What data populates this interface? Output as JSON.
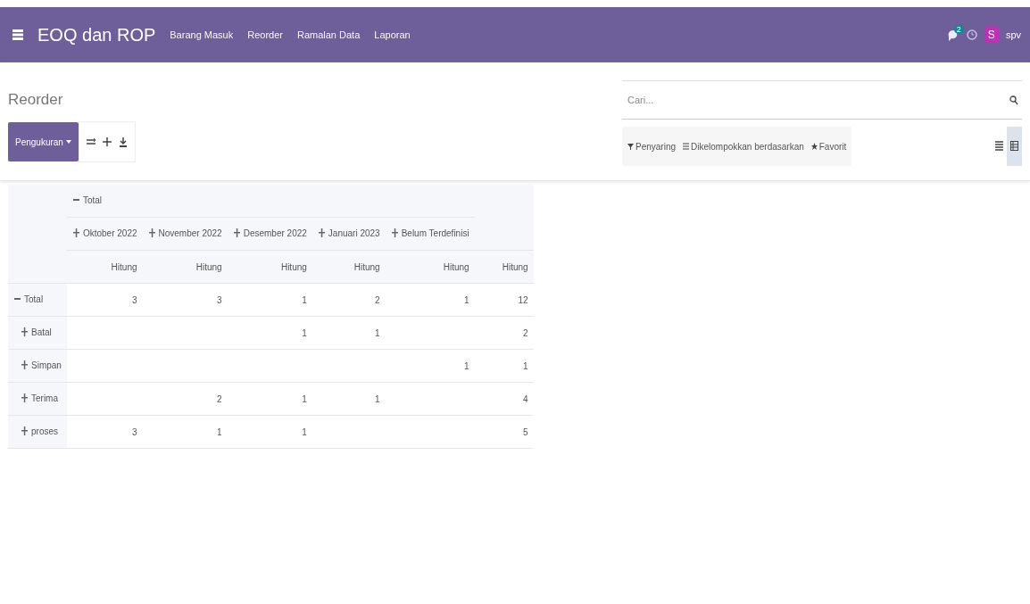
{
  "navbar": {
    "app_title": "EOQ dan ROP",
    "menu": [
      "Barang Masuk",
      "Reorder",
      "Ramalan Data",
      "Laporan"
    ],
    "message_count": "2",
    "user_initial": "S",
    "user_name": "spv"
  },
  "breadcrumb": "Reorder",
  "measures_button": "Pengukuran",
  "search": {
    "placeholder": "Cari..."
  },
  "filters": [
    {
      "kind": "filter",
      "label": "Penyaring"
    },
    {
      "kind": "group",
      "label": "Dikelompokkan berdasarkan"
    },
    {
      "kind": "favorite",
      "label": "Favorit"
    }
  ],
  "views": [
    {
      "kind": "list",
      "selected": false
    },
    {
      "kind": "pivot",
      "selected": true
    }
  ],
  "pivot": {
    "column_total": {
      "label": "Total",
      "expanded": true
    },
    "columns": [
      {
        "label": "Oktober 2022",
        "expanded": false
      },
      {
        "label": "November 2022",
        "expanded": false
      },
      {
        "label": "Desember 2022",
        "expanded": false
      },
      {
        "label": "Januari 2023",
        "expanded": false
      },
      {
        "label": "Belum Terdefinisi",
        "expanded": false
      }
    ],
    "measures": [
      "Hitung",
      "Hitung",
      "Hitung",
      "Hitung",
      "Hitung",
      "Hitung"
    ],
    "rows": [
      {
        "label": "Total",
        "expanded": true,
        "values": {
          "col_1": "3",
          "col_2": "3",
          "col_3": "1",
          "col_4": "2",
          "col_5": "1",
          "total": "12"
        },
        "children": [
          {
            "label": "Batal",
            "expanded": false,
            "values": {
              "col_3": "1",
              "col_4": "1",
              "total": "2"
            }
          },
          {
            "label": "Simpan",
            "expanded": false,
            "values": {
              "col_5": "1",
              "total": "1"
            }
          },
          {
            "label": "Terima",
            "expanded": false,
            "values": {
              "col_2": "2",
              "col_3": "1",
              "col_4": "1",
              "total": "4"
            }
          },
          {
            "label": "proses",
            "expanded": false,
            "values": {
              "col_1": "3",
              "col_2": "1",
              "col_3": "1",
              "total": "5"
            }
          }
        ]
      }
    ]
  }
}
